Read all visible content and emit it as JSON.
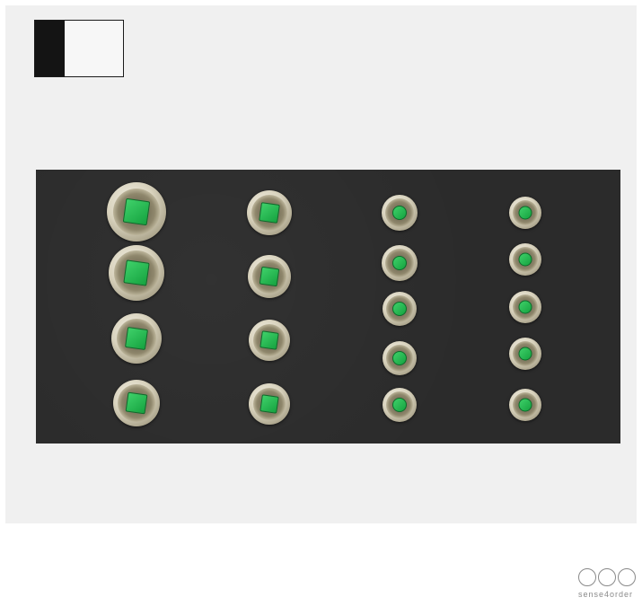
{
  "scene": {
    "description_label": "",
    "logo_text": "sense4order"
  },
  "colors": {
    "tray": "#2b2b2b",
    "insert": "#22b84a",
    "background": "#f0f0f0"
  },
  "sockets": {
    "columns": 4,
    "rows_per_column": [
      4,
      4,
      5,
      5
    ],
    "total": 18
  }
}
